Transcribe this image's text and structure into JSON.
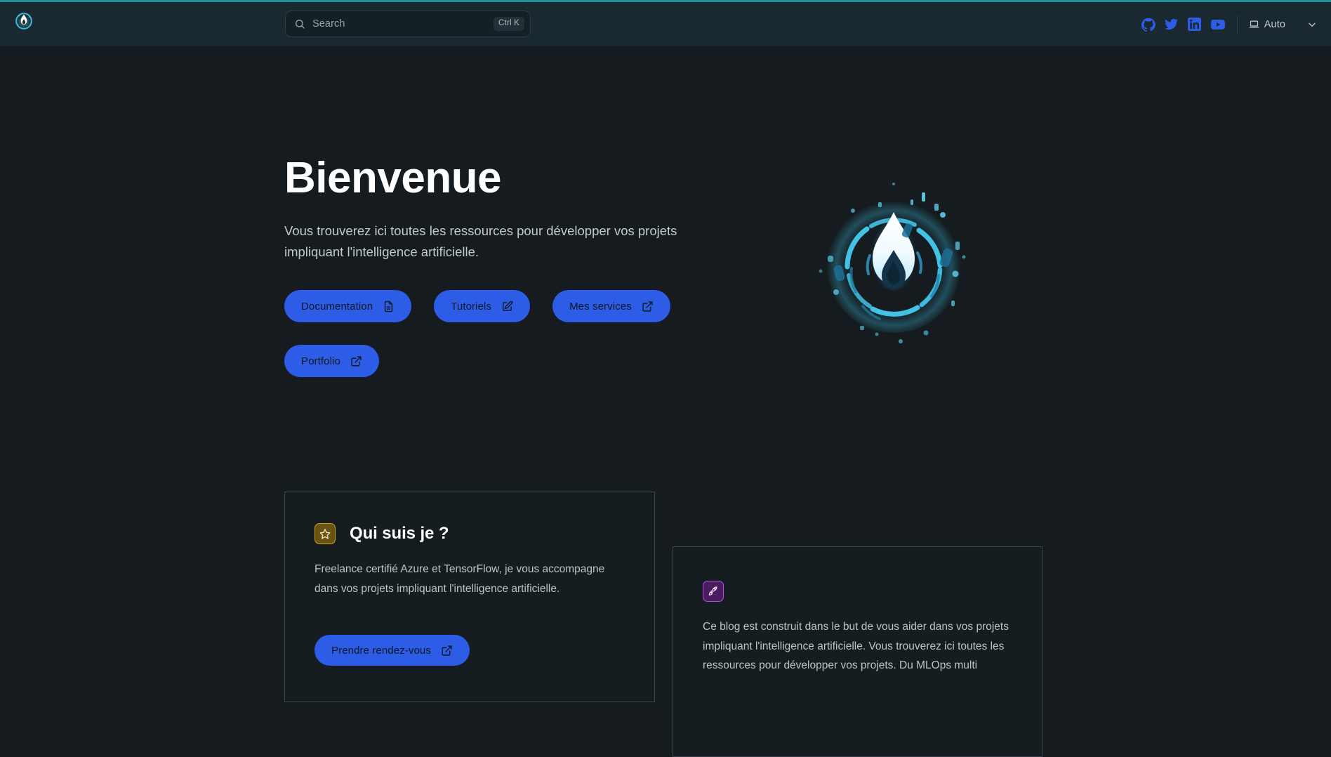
{
  "theme": {
    "page_bg": "#151b1e",
    "header_bg": "#1a2830",
    "accent_top": "#1a8f9e",
    "button_blue": "#2d5ce6",
    "card_bg": "#161d21",
    "card_border": "#384750",
    "star_chip_bg": "#6b5413",
    "star_chip_border": "#c99a26",
    "rocket_chip_bg": "#4a1d60",
    "rocket_chip_border": "#b14fe0",
    "heading_color": "#ffffff",
    "body_text_color": "#bcc5ca"
  },
  "header": {
    "brand_icon": "flame-logo-icon",
    "search": {
      "placeholder": "Search",
      "shortcut": "Ctrl K",
      "icon": "search-icon"
    },
    "social": [
      {
        "name": "github",
        "icon": "github-icon",
        "label": "GitHub"
      },
      {
        "name": "twitter",
        "icon": "twitter-icon",
        "label": "Twitter"
      },
      {
        "name": "linkedin",
        "icon": "linkedin-icon",
        "label": "LinkedIn"
      },
      {
        "name": "youtube",
        "icon": "youtube-icon",
        "label": "YouTube"
      }
    ],
    "theme_switcher": {
      "label": "Auto",
      "icon": "laptop-icon",
      "caret": "chevron-down-icon"
    }
  },
  "hero": {
    "title": "Bienvenue",
    "subtitle": "Vous trouverez ici toutes les ressources pour développer vos projets impliquant l'intelligence artificielle.",
    "logo_icon": "glowing-flame-ring-logo",
    "buttons": [
      {
        "label": "Documentation",
        "icon": "document-icon"
      },
      {
        "label": "Tutoriels",
        "icon": "edit-square-icon"
      },
      {
        "label": "Mes services",
        "icon": "external-link-icon"
      },
      {
        "label": "Portfolio",
        "icon": "external-link-icon"
      }
    ]
  },
  "cards": {
    "about": {
      "icon": "star-icon",
      "title": "Qui suis je ?",
      "body": "Freelance certifié Azure et TensorFlow, je vous accompagne dans vos projets impliquant l'intelligence artificielle.",
      "cta": {
        "label": "Prendre rendez-vous",
        "icon": "external-link-icon"
      }
    },
    "blog": {
      "icon": "rocket-icon",
      "body": "Ce blog est construit dans le but de vous aider dans vos projets impliquant l'intelligence artificielle. Vous trouverez ici toutes les ressources pour développer vos projets. Du MLOps multi"
    }
  }
}
